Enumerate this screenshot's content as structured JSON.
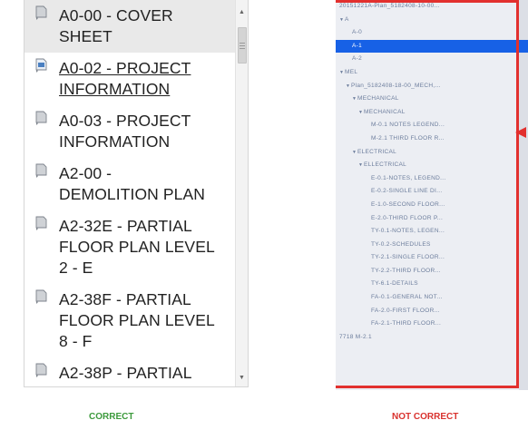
{
  "left_panel": {
    "items": [
      {
        "label": "A0-00 - COVER SHEET",
        "lines": [
          "A0-00 - COVER",
          "SHEET"
        ],
        "selected": true,
        "linked": false
      },
      {
        "label": "A0-02 - PROJECT INFORMATION",
        "lines": [
          "A0-02 - PROJECT",
          "INFORMATION"
        ],
        "selected": false,
        "linked": true
      },
      {
        "label": "A0-03 - PROJECT INFORMATION",
        "lines": [
          "A0-03 - PROJECT",
          "INFORMATION"
        ],
        "selected": false,
        "linked": false
      },
      {
        "label": "A2-00 - DEMOLITION PLAN",
        "lines": [
          "A2-00 -",
          "DEMOLITION PLAN"
        ],
        "selected": false,
        "linked": false
      },
      {
        "label": "A2-32E - PARTIAL FLOOR PLAN LEVEL 2 - E",
        "lines": [
          "A2-32E - PARTIAL",
          "FLOOR PLAN LEVEL",
          "2 - E"
        ],
        "selected": false,
        "linked": false
      },
      {
        "label": "A2-38F - PARTIAL FLOOR PLAN LEVEL 8 - F",
        "lines": [
          "A2-38F - PARTIAL",
          "FLOOR PLAN LEVEL",
          "8 - F"
        ],
        "selected": false,
        "linked": false
      },
      {
        "label": "A2-38P - PARTIAL",
        "lines": [
          "A2-38P - PARTIAL"
        ],
        "selected": false,
        "linked": false
      }
    ],
    "caption": "CORRECT",
    "caption_color": "#3c9a3c"
  },
  "right_panel": {
    "rows": [
      {
        "text": "20151221A-Plan_5182408-10-00...",
        "indent": 0,
        "toggle": "",
        "selected": false
      },
      {
        "text": "A",
        "indent": 0,
        "toggle": "▼",
        "selected": false
      },
      {
        "text": "A-0",
        "indent": 2,
        "toggle": "",
        "selected": false
      },
      {
        "text": "A-1",
        "indent": 2,
        "toggle": "",
        "selected": true
      },
      {
        "text": "A-2",
        "indent": 2,
        "toggle": "",
        "selected": false
      },
      {
        "text": "MEL",
        "indent": 0,
        "toggle": "▼",
        "selected": false
      },
      {
        "text": "Plan_5182408-18-00_MECH,...",
        "indent": 1,
        "toggle": "▼",
        "selected": false
      },
      {
        "text": "MECHANICAL",
        "indent": 2,
        "toggle": "▼",
        "selected": false
      },
      {
        "text": "MECHANICAL",
        "indent": 3,
        "toggle": "▼",
        "selected": false
      },
      {
        "text": "M-0.1 NOTES LEGEND...",
        "indent": 5,
        "toggle": "",
        "selected": false
      },
      {
        "text": "M-2.1 THIRD FLOOR R...",
        "indent": 5,
        "toggle": "",
        "selected": false
      },
      {
        "text": "ELECTRICAL",
        "indent": 2,
        "toggle": "▼",
        "selected": false
      },
      {
        "text": "ELLECTRICAL",
        "indent": 3,
        "toggle": "▼",
        "selected": false
      },
      {
        "text": "E-0.1-NOTES, LEGEND...",
        "indent": 5,
        "toggle": "",
        "selected": false
      },
      {
        "text": "E-0.2-SINGLE LINE DI...",
        "indent": 5,
        "toggle": "",
        "selected": false
      },
      {
        "text": "E-1.0-SECOND FLOOR...",
        "indent": 5,
        "toggle": "",
        "selected": false
      },
      {
        "text": "E-2.0-THIRD FLOOR P...",
        "indent": 5,
        "toggle": "",
        "selected": false
      },
      {
        "text": "TY-0.1-NOTES, LEGEN...",
        "indent": 5,
        "toggle": "",
        "selected": false
      },
      {
        "text": "TY-0.2-SCHEDULES",
        "indent": 5,
        "toggle": "",
        "selected": false
      },
      {
        "text": "TY-2.1-SINGLE FLOOR...",
        "indent": 5,
        "toggle": "",
        "selected": false
      },
      {
        "text": "TY-2.2-THIRD FLOOR...",
        "indent": 5,
        "toggle": "",
        "selected": false
      },
      {
        "text": "TY-6.1-DETAILS",
        "indent": 5,
        "toggle": "",
        "selected": false
      },
      {
        "text": "FA-0.1-GENERAL NOT...",
        "indent": 5,
        "toggle": "",
        "selected": false
      },
      {
        "text": "FA-2.0-FIRST FLOOR...",
        "indent": 5,
        "toggle": "",
        "selected": false
      },
      {
        "text": "FA-2.1-THIRD FLOOR...",
        "indent": 5,
        "toggle": "",
        "selected": false
      },
      {
        "text": "7718 M-2.1",
        "indent": 0,
        "toggle": "",
        "selected": false
      }
    ],
    "caption": "NOT CORRECT",
    "caption_color": "#d9322e",
    "highlight_color": "#e2302e",
    "selection_color": "#1761e6"
  },
  "icons": {
    "sheet": "sheet-icon",
    "linked_sheet": "linked-sheet-icon",
    "scroll_up": "scroll-up-arrow-icon",
    "scroll_down": "scroll-down-arrow-icon",
    "pointer": "red-arrow-icon"
  }
}
